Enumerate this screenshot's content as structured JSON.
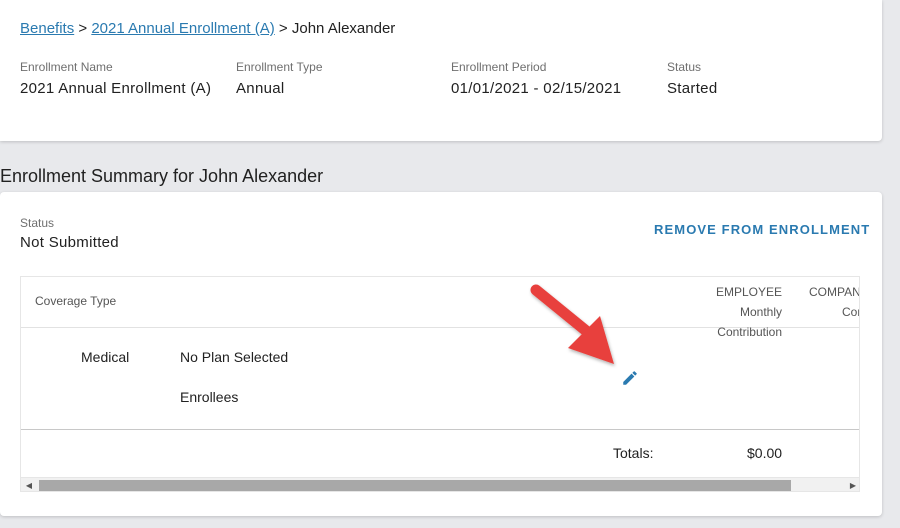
{
  "breadcrumb": {
    "link1": "Benefits",
    "sep1": " > ",
    "link2": "2021 Annual Enrollment (A)",
    "sep2": " > ",
    "current": "John Alexander"
  },
  "enrollment": {
    "name_label": "Enrollment Name",
    "name_value": "2021 Annual Enrollment (A)",
    "type_label": "Enrollment Type",
    "type_value": "Annual",
    "period_label": "Enrollment Period",
    "period_value": "01/01/2021 - 02/15/2021",
    "status_label": "Status",
    "status_value": "Started"
  },
  "summary": {
    "title": "Enrollment Summary for John Alexander",
    "status_label": "Status",
    "status_value": "Not Submitted",
    "remove_label": "REMOVE FROM ENROLLMENT"
  },
  "table": {
    "headers": {
      "coverage_type": "Coverage Type",
      "employee_line1": "EMPLOYEE Monthly",
      "employee_line2": "Contribution",
      "company_line1": "COMPANY",
      "company_line2": "Con"
    },
    "row": {
      "coverage": "Medical",
      "plan": "No Plan Selected",
      "enrollees": "Enrollees"
    },
    "totals_label": "Totals:",
    "totals_value": "$0.00"
  },
  "icons": {
    "edit": "pencil-icon",
    "annotation": "red-arrow"
  },
  "colors": {
    "link": "#2a7ab0",
    "arrow": "#e8403c"
  }
}
